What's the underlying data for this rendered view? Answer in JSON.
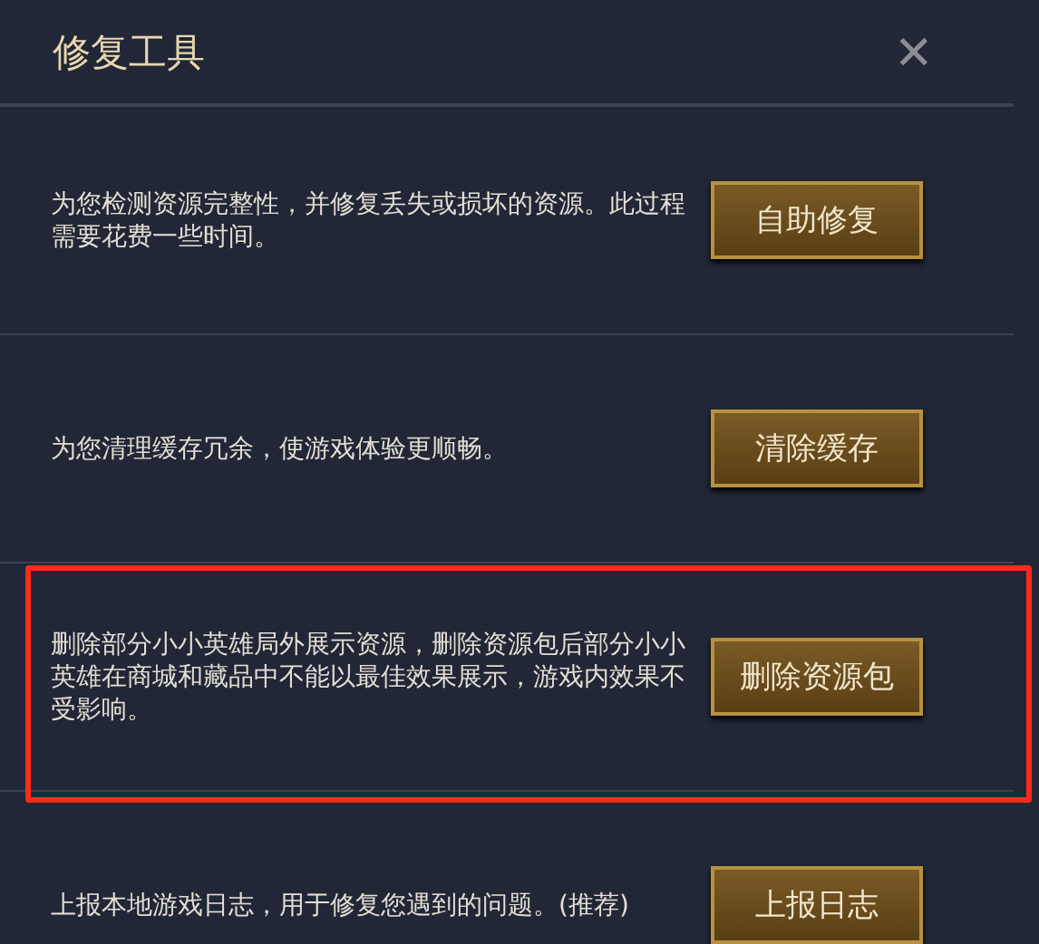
{
  "window": {
    "title": "修复工具",
    "close": "✕"
  },
  "rows": [
    {
      "description": "为您检测资源完整性，并修复丢失或损坏的资源。此过程需要花费一些时间。",
      "button": "自助修复",
      "highlighted": false
    },
    {
      "description": "为您清理缓存冗余，使游戏体验更顺畅。",
      "button": "清除缓存",
      "highlighted": false
    },
    {
      "description": "删除部分小小英雄局外展示资源，删除资源包后部分小小英雄在商城和藏品中不能以最佳效果展示，游戏内效果不受影响。",
      "button": "删除资源包",
      "highlighted": true
    },
    {
      "description": "上报本地游戏日志，用于修复您遇到的问题。(推荐)",
      "button": "上报日志",
      "highlighted": false
    }
  ]
}
